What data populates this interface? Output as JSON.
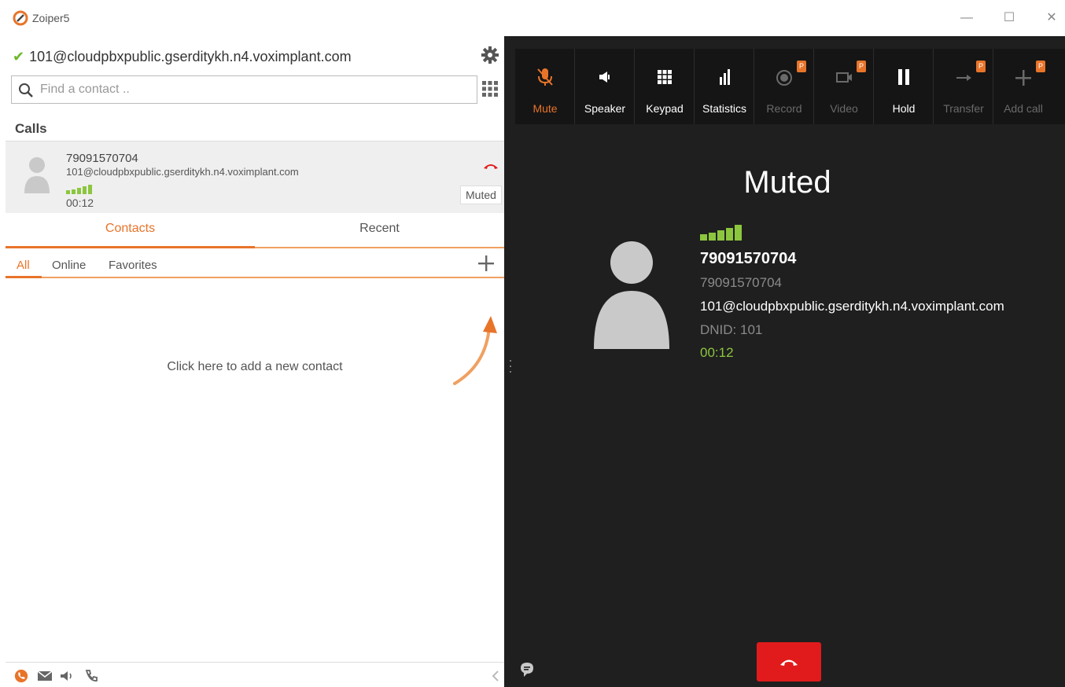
{
  "window": {
    "title": "Zoiper5",
    "controls": {
      "minimize": "—",
      "maximize": "☐",
      "close": "✕"
    }
  },
  "account": {
    "status_icon": "check-icon",
    "address": "101@cloudpbxpublic.gserditykh.n4.voximplant.com"
  },
  "search": {
    "placeholder": "Find a contact .."
  },
  "calls": {
    "header": "Calls",
    "items": [
      {
        "number": "79091570704",
        "sip": "101@cloudpbxpublic.gserditykh.n4.voximplant.com",
        "duration": "00:12",
        "status": "Muted",
        "signal_bars": 5
      }
    ]
  },
  "tabs": {
    "contacts": "Contacts",
    "recent": "Recent",
    "active": "Contacts"
  },
  "subtabs": {
    "all": "All",
    "online": "Online",
    "favorites": "Favorites",
    "active": "All"
  },
  "empty_state": {
    "hint": "Click here to add a new contact"
  },
  "bottom_bar": {
    "icons": [
      "phone-icon",
      "message-icon",
      "speaker-icon",
      "call-history-icon",
      "collapse-icon"
    ]
  },
  "toolbar": {
    "pro_badge": "P",
    "items": [
      {
        "label": "Mute",
        "icon": "mic-muted-icon",
        "state": "active"
      },
      {
        "label": "Speaker",
        "icon": "speaker-icon",
        "state": "enabled"
      },
      {
        "label": "Keypad",
        "icon": "keypad-icon",
        "state": "enabled"
      },
      {
        "label": "Statistics",
        "icon": "statistics-icon",
        "state": "enabled"
      },
      {
        "label": "Record",
        "icon": "record-icon",
        "state": "disabled-pro"
      },
      {
        "label": "Video",
        "icon": "video-icon",
        "state": "disabled-pro"
      },
      {
        "label": "Hold",
        "icon": "pause-icon",
        "state": "enabled"
      },
      {
        "label": "Transfer",
        "icon": "transfer-icon",
        "state": "disabled-pro"
      },
      {
        "label": "Add call",
        "icon": "add-call-icon",
        "state": "disabled-pro"
      }
    ]
  },
  "active_call": {
    "state": "Muted",
    "number": "79091570704",
    "subtitle": "79091570704",
    "sip": "101@cloudpbxpublic.gserditykh.n4.voximplant.com",
    "dnid": "DNID: 101",
    "duration": "00:12",
    "signal_bars": 5
  },
  "colors": {
    "accent": "#e8742a",
    "signal": "#8cc63f",
    "hangup": "#e11b1b",
    "dark_bg": "#1f1f1f",
    "toolbar_bg": "#151515",
    "check": "#6bb82a"
  }
}
